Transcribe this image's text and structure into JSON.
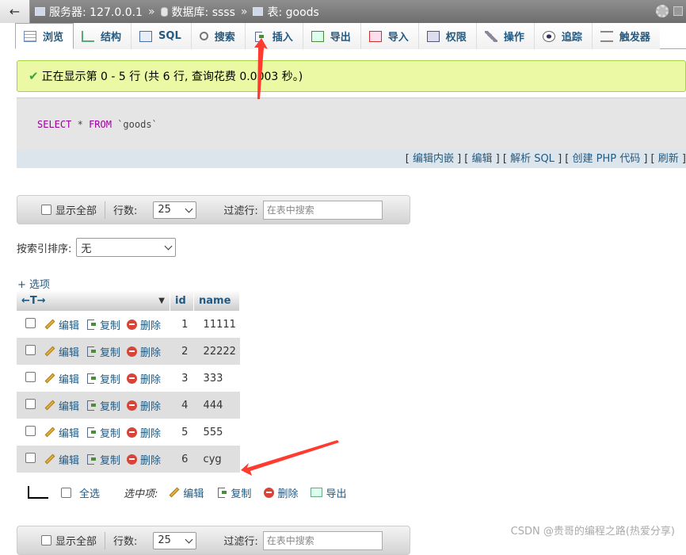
{
  "breadcrumb": {
    "server_label": "服务器: 127.0.0.1",
    "database_label": "数据库: ssss",
    "table_label": "表: goods"
  },
  "tabs": [
    {
      "label": "浏览",
      "icon": "browse-icon",
      "active": true
    },
    {
      "label": "结构",
      "icon": "structure-icon",
      "active": false
    },
    {
      "label": "SQL",
      "icon": "sql-icon",
      "active": false
    },
    {
      "label": "搜索",
      "icon": "search-icon",
      "active": false
    },
    {
      "label": "插入",
      "icon": "insert-icon",
      "active": false
    },
    {
      "label": "导出",
      "icon": "export-icon",
      "active": false
    },
    {
      "label": "导入",
      "icon": "import-icon",
      "active": false
    },
    {
      "label": "权限",
      "icon": "privileges-icon",
      "active": false
    },
    {
      "label": "操作",
      "icon": "wrench-icon",
      "active": false
    },
    {
      "label": "追踪",
      "icon": "eye-icon",
      "active": false
    },
    {
      "label": "触发器",
      "icon": "trigger-icon",
      "active": false
    }
  ],
  "success_message": "正在显示第 0 - 5 行 (共 6 行, 查询花费 0.0003 秒。)",
  "sql": {
    "kw1": "SELECT",
    "star": "*",
    "kw2": "FROM",
    "table": "`goods`"
  },
  "sql_links": [
    "编辑内嵌",
    "编辑",
    "解析 SQL",
    "创建 PHP 代码",
    "刷新"
  ],
  "nav": {
    "show_all": "显示全部",
    "rows_label": "行数:",
    "rows_value": "25",
    "filter_label": "过滤行:",
    "filter_placeholder": "在表中搜索"
  },
  "sort": {
    "label": "按索引排序:",
    "value": "无"
  },
  "options_link": "+ 选项",
  "table": {
    "col_toggle": "←T→",
    "columns": [
      "id",
      "name"
    ],
    "actions": {
      "edit": "编辑",
      "copy": "复制",
      "delete": "删除"
    },
    "rows": [
      {
        "id": "1",
        "name": "11111"
      },
      {
        "id": "2",
        "name": "22222"
      },
      {
        "id": "3",
        "name": "333"
      },
      {
        "id": "4",
        "name": "444"
      },
      {
        "id": "5",
        "name": "555"
      },
      {
        "id": "6",
        "name": "cyg"
      }
    ]
  },
  "bulk": {
    "select_all": "全选",
    "with_selected": "选中项:",
    "edit": "编辑",
    "copy": "复制",
    "delete": "删除",
    "export": "导出"
  },
  "watermark": "CSDN @贵哥的编程之路(热爱分享)",
  "colors": {
    "link": "#235a81",
    "success_bg": "#ebf8a4",
    "annotation_red": "#ff3b30"
  }
}
